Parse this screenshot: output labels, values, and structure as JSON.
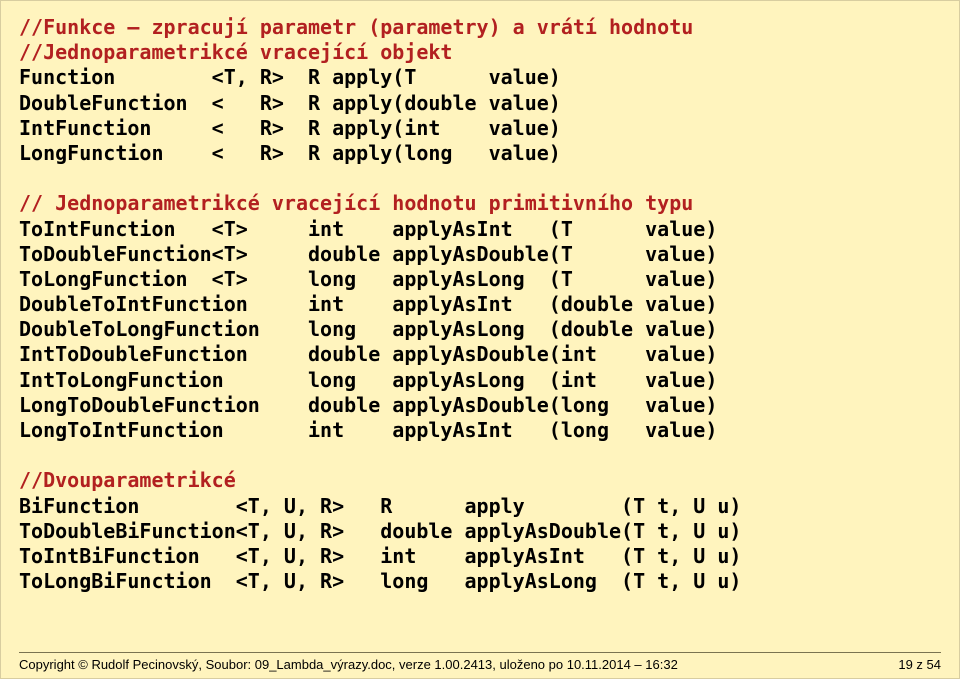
{
  "section1": {
    "comment1": "//Funkce – zpracují parametr (parametry) a vrátí hodnotu",
    "comment2": "//Jednoparametrikcé vracející objekt",
    "rows": [
      {
        "name": "Function",
        "gen": "<T, R>",
        "ret": "R",
        "method": "apply(T",
        "param": "value)"
      },
      {
        "name": "DoubleFunction",
        "gen": "<   R>",
        "ret": "R",
        "method": "apply(double",
        "param": "value)"
      },
      {
        "name": "IntFunction",
        "gen": "<   R>",
        "ret": "R",
        "method": "apply(int",
        "param": "value)"
      },
      {
        "name": "LongFunction",
        "gen": "<   R>",
        "ret": "R",
        "method": "apply(long",
        "param": "value)"
      }
    ]
  },
  "section2": {
    "comment": "// Jednoparametrikcé vracející hodnotu primitivního typu",
    "rows": [
      {
        "name": "ToIntFunction   <T>",
        "ret": "int",
        "method": "applyAsInt   (T",
        "param": "value)"
      },
      {
        "name": "ToDoubleFunction<T>",
        "ret": "double",
        "method": "applyAsDouble(T",
        "param": "value)"
      },
      {
        "name": "ToLongFunction  <T>",
        "ret": "long",
        "method": "applyAsLong  (T",
        "param": "value)"
      },
      {
        "name": "DoubleToIntFunction",
        "ret": "int",
        "method": "applyAsInt   (double",
        "param": "value)"
      },
      {
        "name": "DoubleToLongFunction",
        "ret": "long",
        "method": "applyAsLong  (double",
        "param": "value)"
      },
      {
        "name": "IntToDoubleFunction",
        "ret": "double",
        "method": "applyAsDouble(int",
        "param": "value)"
      },
      {
        "name": "IntToLongFunction",
        "ret": "long",
        "method": "applyAsLong  (int",
        "param": "value)"
      },
      {
        "name": "LongToDoubleFunction",
        "ret": "double",
        "method": "applyAsDouble(long",
        "param": "value)"
      },
      {
        "name": "LongToIntFunction",
        "ret": "int",
        "method": "applyAsInt   (long",
        "param": "value)"
      }
    ]
  },
  "section3": {
    "comment": "//Dvouparametrikcé",
    "rows": [
      {
        "name": "BiFunction        <T, U, R>",
        "ret": "R",
        "method": "apply        (T t,",
        "param": "U u)"
      },
      {
        "name": "ToDoubleBiFunction<T, U, R>",
        "ret": "double",
        "method": "applyAsDouble(T t,",
        "param": "U u)"
      },
      {
        "name": "ToIntBiFunction   <T, U, R>",
        "ret": "int",
        "method": "applyAsInt   (T t,",
        "param": "U u)"
      },
      {
        "name": "ToLongBiFunction  <T, U, R>",
        "ret": "long",
        "method": "applyAsLong  (T t,",
        "param": "U u)"
      }
    ]
  },
  "footer": {
    "copyright": "Copyright © Rudolf Pecinovský, Soubor: 09_Lambda_výrazy.doc, verze 1.00.2413, uloženo po 10.11.2014 – 16:32",
    "page": "19 z 54"
  },
  "cols": {
    "s1": {
      "name": 16,
      "gen": 8,
      "ret": 2,
      "method": 13,
      "param": 6
    },
    "s2": {
      "name": 24,
      "ret": 7,
      "method": 21,
      "param": 6
    },
    "s3": {
      "name": 30,
      "ret": 7,
      "method": 19,
      "param": 5
    }
  }
}
